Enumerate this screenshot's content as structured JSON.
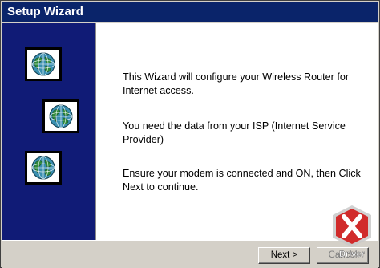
{
  "window": {
    "title": "Setup Wizard"
  },
  "wizard": {
    "paragraphs": [
      "This Wizard will configure your Wireless Router for Internet access.",
      "You need the data from your ISP (Internet Service Provider)",
      "Ensure your modem is connected and ON, then Click Next to continue."
    ]
  },
  "buttons": {
    "next_label": "Next >",
    "cancel_label": "Cancel"
  },
  "watermark": {
    "text": "Driver"
  },
  "colors": {
    "title_bar": "#0a246a",
    "side_panel": "#101b76",
    "dialog_bg": "#d4d0c8",
    "watermark_red": "#d01818"
  },
  "icons": {
    "globe": "globe-icon"
  }
}
